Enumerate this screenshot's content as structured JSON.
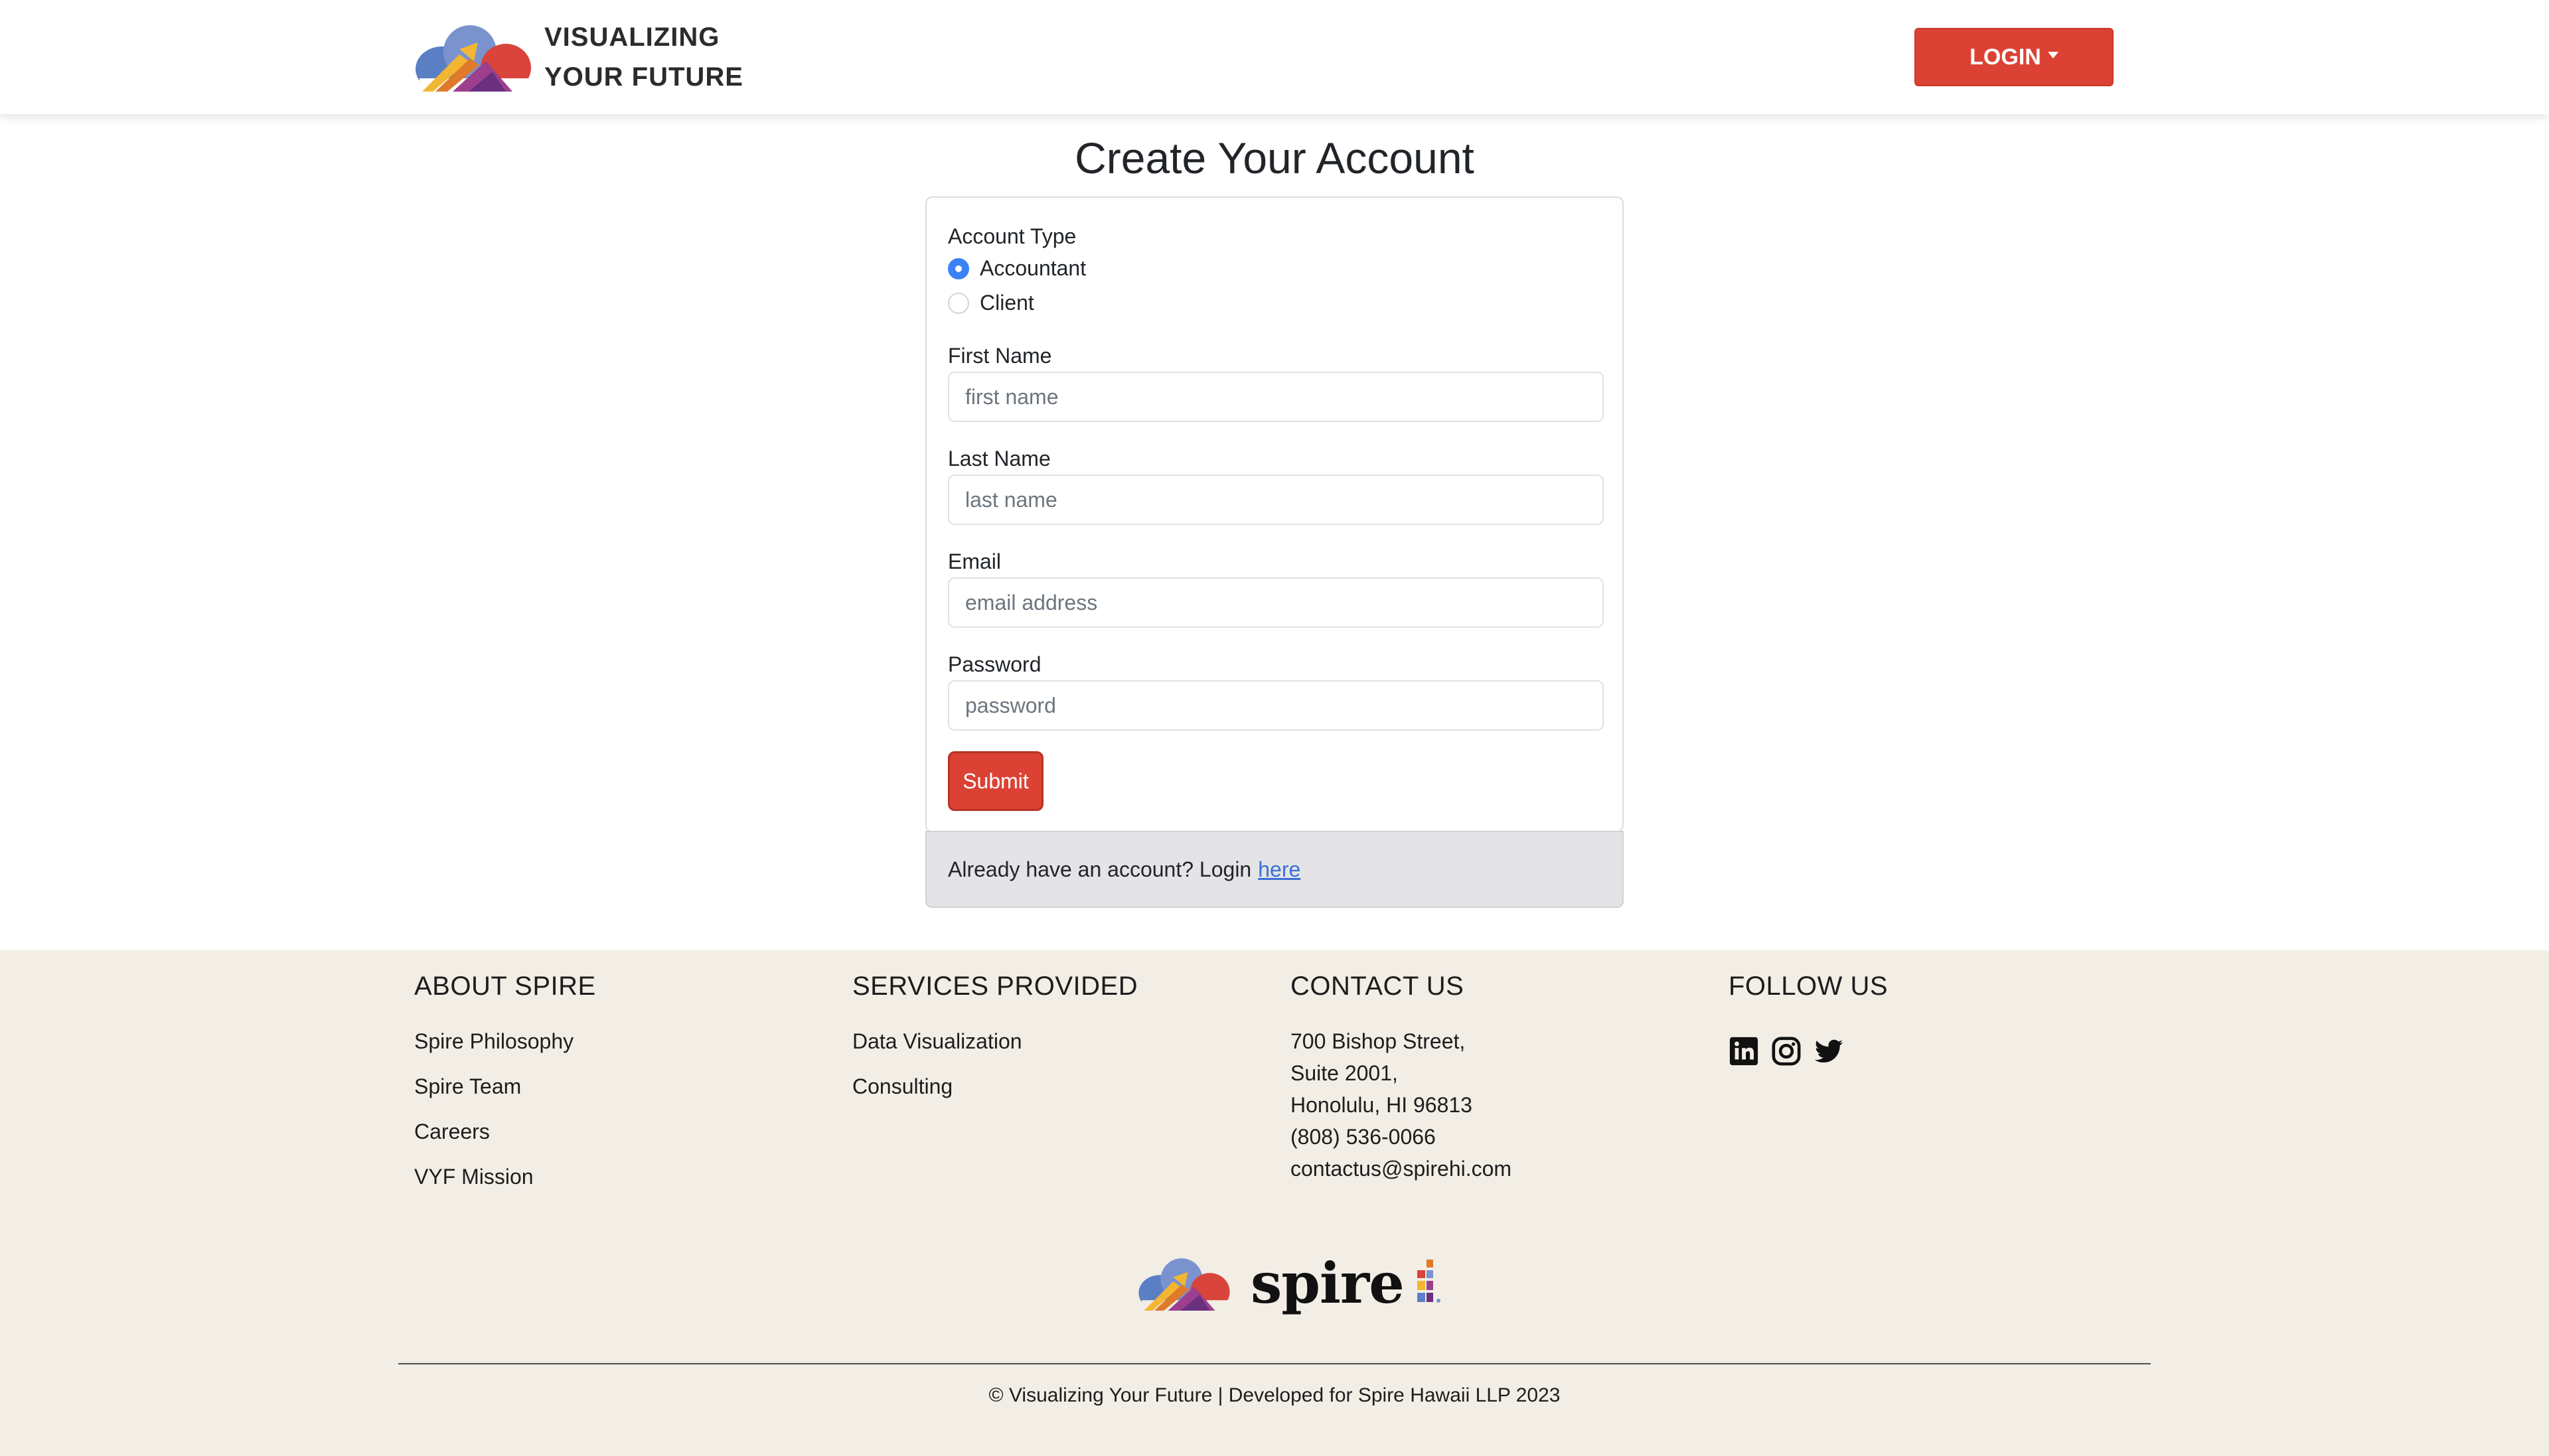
{
  "nav": {
    "brand_line1": "VISUALIZING",
    "brand_line2": "YOUR FUTURE",
    "login_label": "LOGIN"
  },
  "page": {
    "title": "Create Your Account"
  },
  "form": {
    "account_type_label": "Account Type",
    "options": [
      {
        "label": "Accountant",
        "checked": true
      },
      {
        "label": "Client",
        "checked": false
      }
    ],
    "first_name": {
      "label": "First Name",
      "placeholder": "first name",
      "value": ""
    },
    "last_name": {
      "label": "Last Name",
      "placeholder": "last name",
      "value": ""
    },
    "email": {
      "label": "Email",
      "placeholder": "email address",
      "value": ""
    },
    "password": {
      "label": "Password",
      "placeholder": "password",
      "value": ""
    },
    "submit_label": "Submit"
  },
  "card_footer": {
    "text": "Already have an account? Login",
    "link_label": "here"
  },
  "footer": {
    "about": {
      "heading": "ABOUT SPIRE",
      "links": [
        "Spire Philosophy",
        "Spire Team",
        "Careers",
        "VYF Mission"
      ]
    },
    "services": {
      "heading": "SERVICES PROVIDED",
      "links": [
        "Data Visualization",
        "Consulting"
      ]
    },
    "contact": {
      "heading": "CONTACT US",
      "lines": [
        "700 Bishop Street,",
        "Suite 2001,",
        "Honolulu, HI 96813",
        "(808) 536-0066",
        "contactus@spirehi.com"
      ]
    },
    "follow": {
      "heading": "FOLLOW US",
      "icons": [
        "linkedin-icon",
        "instagram-icon",
        "twitter-icon"
      ]
    },
    "spire_wordmark": "spire",
    "copyright": "© Visualizing Your Future | Developed for Spire Hawaii LLP 2023"
  },
  "colors": {
    "accent": "#dc4234",
    "footer_bg": "#f2eee6",
    "radio_checked": "#3b82f6",
    "link": "#3b6fd8"
  }
}
